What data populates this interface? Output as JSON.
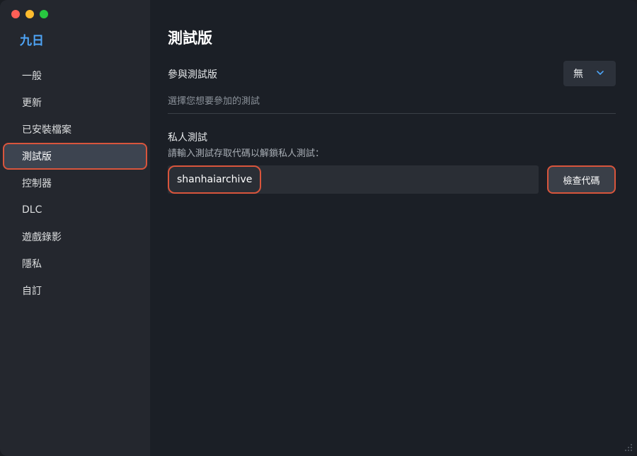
{
  "app": {
    "title": "九日"
  },
  "sidebar": {
    "items": [
      {
        "label": "一般"
      },
      {
        "label": "更新"
      },
      {
        "label": "已安裝檔案"
      },
      {
        "label": "測試版"
      },
      {
        "label": "控制器"
      },
      {
        "label": "DLC"
      },
      {
        "label": "遊戲錄影"
      },
      {
        "label": "隱私"
      },
      {
        "label": "自訂"
      }
    ],
    "active_index": 3
  },
  "main": {
    "title": "測試版",
    "beta": {
      "label": "參與測試版",
      "selected": "無",
      "description": "選擇您想要參加的測試"
    },
    "private": {
      "title": "私人測試",
      "description": "請輸入測試存取代碼以解鎖私人測試：",
      "code_value": "shanhaiarchive",
      "check_button": "檢查代碼"
    }
  },
  "colors": {
    "accent": "#4ea4f6",
    "highlight": "#d9553c"
  },
  "icons": {
    "close": "close-icon",
    "minimize": "minimize-icon",
    "zoom": "zoom-icon",
    "dropdown": "chevron-down-icon",
    "resize": "resize-grip-icon"
  }
}
